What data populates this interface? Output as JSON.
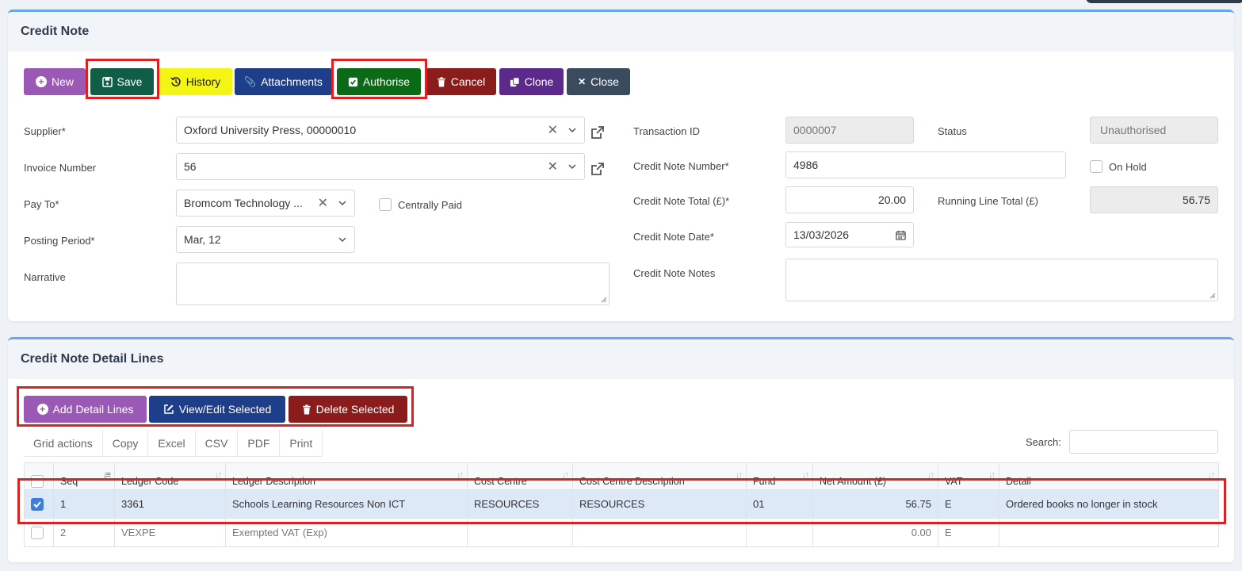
{
  "panel1": {
    "title": "Credit Note",
    "buttons": {
      "new": "New",
      "save": "Save",
      "history": "History",
      "attachments": "Attachments",
      "authorise": "Authorise",
      "cancel": "Cancel",
      "clone": "Clone",
      "close": "Close"
    },
    "left": {
      "supplier_label": "Supplier*",
      "supplier_value": "Oxford University Press, 00000010",
      "invoice_label": "Invoice Number",
      "invoice_value": "56",
      "payto_label": "Pay To*",
      "payto_value": "Bromcom Technology ...",
      "centrally_paid_label": "Centrally Paid",
      "posting_label": "Posting Period*",
      "posting_value": "Mar, 12",
      "narrative_label": "Narrative",
      "narrative_value": ""
    },
    "right": {
      "txid_label": "Transaction ID",
      "txid_value": "0000007",
      "status_label": "Status",
      "status_value": "Unauthorised",
      "cn_number_label": "Credit Note Number*",
      "cn_number_value": "4986",
      "on_hold_label": "On Hold",
      "cn_total_label": "Credit Note Total (£)*",
      "cn_total_value": "20.00",
      "running_label": "Running Line Total (£)",
      "running_value": "56.75",
      "cn_date_label": "Credit Note Date*",
      "cn_date_value": "13/03/2026",
      "cn_notes_label": "Credit Note Notes",
      "cn_notes_value": ""
    }
  },
  "panel2": {
    "title": "Credit Note Detail Lines",
    "buttons": {
      "add": "Add Detail Lines",
      "view_edit": "View/Edit Selected",
      "delete": "Delete Selected"
    },
    "grid_tabs": [
      "Grid actions",
      "Copy",
      "Excel",
      "CSV",
      "PDF",
      "Print"
    ],
    "search_label": "Search:",
    "columns": [
      "Seq",
      "Ledger Code",
      "Ledger Description",
      "Cost Centre",
      "Cost Centre Description",
      "Fund",
      "Net Amount (£)",
      "VAT",
      "Detail"
    ],
    "rows": [
      {
        "seq": "1",
        "ledger_code": "3361",
        "ledger_desc": "Schools Learning Resources Non ICT",
        "cost_centre": "RESOURCES",
        "cc_desc": "RESOURCES",
        "fund": "01",
        "net": "56.75",
        "vat": "E",
        "detail": "Ordered books no longer in stock",
        "checked": true
      },
      {
        "seq": "2",
        "ledger_code": "VEXPE",
        "ledger_desc": "Exempted VAT (Exp)",
        "cost_centre": "",
        "cc_desc": "",
        "fund": "",
        "net": "0.00",
        "vat": "E",
        "detail": "",
        "checked": false
      }
    ]
  },
  "colors": {
    "new": "#9b59b6",
    "save": "#115e46",
    "history": "#f5f513",
    "attachments": "#1f3e8a",
    "authorise": "#0b6a16",
    "cancel": "#8a1c1c",
    "clone": "#5b2a8a",
    "close": "#3b4b5e",
    "highlight": "#e02020"
  }
}
